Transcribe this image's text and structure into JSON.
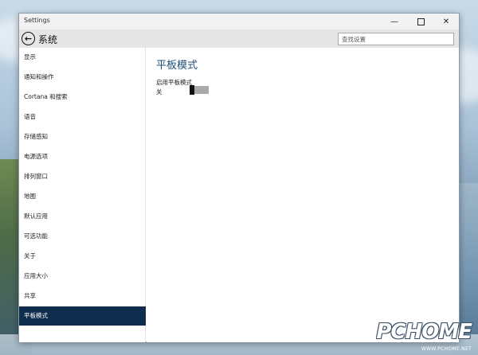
{
  "window": {
    "title": "Settings",
    "minimize_glyph": "—",
    "close_glyph": "✕"
  },
  "appbar": {
    "title": "系统",
    "back_glyph": "←",
    "search_placeholder": "查找设置"
  },
  "sidebar": {
    "items": [
      {
        "label": "显示"
      },
      {
        "label": "通知和操作"
      },
      {
        "label": "Cortana 和搜索"
      },
      {
        "label": "语音"
      },
      {
        "label": "存储感知"
      },
      {
        "label": "电源选项"
      },
      {
        "label": "排列窗口"
      },
      {
        "label": "地图"
      },
      {
        "label": "默认应用"
      },
      {
        "label": "可选功能"
      },
      {
        "label": "关于"
      },
      {
        "label": "应用大小"
      },
      {
        "label": "共享"
      },
      {
        "label": "平板模式"
      }
    ],
    "selected": "平板模式"
  },
  "content": {
    "page_title": "平板模式",
    "setting_label": "启用平板模式",
    "toggle_state": "关",
    "toggle_on": false
  },
  "watermark": {
    "main": "PCHOME",
    "sub": "WWW.PCHOME.NET"
  },
  "colors": {
    "accent": "#0f2e4d",
    "title_blue": "#1f4e79",
    "toggle_off_track": "#a9a9a9"
  }
}
